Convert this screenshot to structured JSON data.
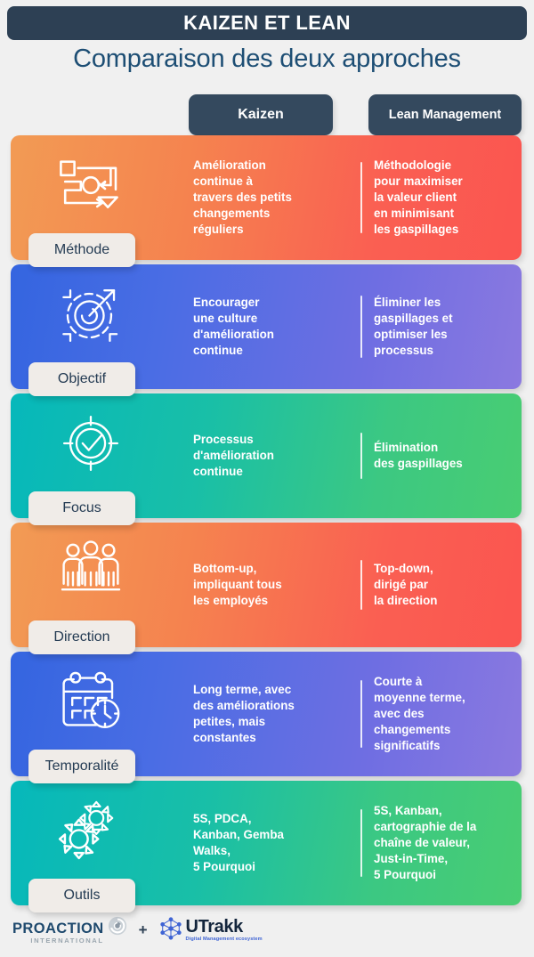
{
  "header": {
    "title": "KAIZEN ET LEAN",
    "subtitle": "Comparaison des deux approches",
    "columns": [
      {
        "label": "Kaizen"
      },
      {
        "label": "Lean Management"
      }
    ]
  },
  "rows": [
    {
      "name": "Méthode",
      "icon": "flowchart-icon",
      "theme": "orange",
      "kaizen": "Amélioration\ncontinue à\ntravers des petits\nchangements\nréguliers",
      "lean": "Méthodologie\npour maximiser\nla valeur client\nen minimisant\nles gaspillages"
    },
    {
      "name": "Objectif",
      "icon": "target-arrow-icon",
      "theme": "blue",
      "kaizen": "Encourager\nune culture\nd'amélioration\ncontinue",
      "lean": "Éliminer les\ngaspillages et\noptimiser les\nprocessus"
    },
    {
      "name": "Focus",
      "icon": "target-check-icon",
      "theme": "green",
      "kaizen": "Processus\nd'amélioration\ncontinue",
      "lean": "Élimination\ndes gaspillages"
    },
    {
      "name": "Direction",
      "icon": "people-group-icon",
      "theme": "orange",
      "kaizen": "Bottom-up,\nimpliquant tous\nles employés",
      "lean": "Top-down,\ndirigé par\nla direction"
    },
    {
      "name": "Temporalité",
      "icon": "calendar-clock-icon",
      "theme": "blue",
      "kaizen": "Long terme, avec\ndes améliorations\npetites, mais\nconstantes",
      "lean": "Courte à\nmoyenne terme,\navec des\nchangements\nsignificatifs"
    },
    {
      "name": "Outils",
      "icon": "gears-icon",
      "theme": "green",
      "kaizen": "5S, PDCA,\nKanban, Gemba\nWalks,\n5 Pourquoi",
      "lean": "5S, Kanban,\ncartographie de la\nchaîne de valeur,\nJust-in-Time,\n5 Pourquoi"
    }
  ],
  "footer": {
    "proaction_name": "PROACTION",
    "proaction_sub": "INTERNATIONAL",
    "separator": "+",
    "utrakk_name": "UTrakk",
    "utrakk_sub": "Digital Management ecosystem"
  },
  "colors": {
    "navy": "#2d4054",
    "subtitle": "#1d4e74",
    "tab_bg": "#34495e",
    "label_tab_bg": "#f0ece8",
    "page_bg": "#f0f0f0",
    "orange_start": "#f29b54",
    "orange_end": "#fb5550",
    "blue_start": "#3465e0",
    "blue_end": "#8b79e0",
    "green_start": "#06b8bb",
    "green_end": "#49cd72"
  }
}
